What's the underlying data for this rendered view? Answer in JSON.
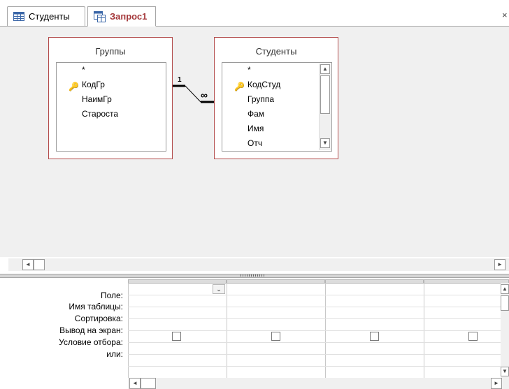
{
  "tabs": [
    {
      "label": "Студенты",
      "icon": "table-icon"
    },
    {
      "label": "Запрос1",
      "icon": "query-icon"
    }
  ],
  "close_glyph": "×",
  "tables": {
    "groups": {
      "title": "Группы",
      "fields": [
        "*",
        "КодГр",
        "НаимГр",
        "Староста"
      ],
      "key_field": "КодГр"
    },
    "students": {
      "title": "Студенты",
      "fields": [
        "*",
        "КодСтуд",
        "Группа",
        "Фам",
        "Имя",
        "Отч"
      ],
      "key_field": "КодСтуд"
    }
  },
  "relationship": {
    "one_label": "1",
    "many_label": "∞"
  },
  "qbe": {
    "row_labels": [
      "Поле:",
      "Имя таблицы:",
      "Сортировка:",
      "Вывод на экран:",
      "Условие отбора:",
      "или:"
    ],
    "columns": 4,
    "show_checked": [
      false,
      false,
      false,
      false
    ]
  },
  "scroll": {
    "left": "◄",
    "right": "►",
    "up": "▲",
    "down": "▼",
    "dropdown": "⌄"
  }
}
